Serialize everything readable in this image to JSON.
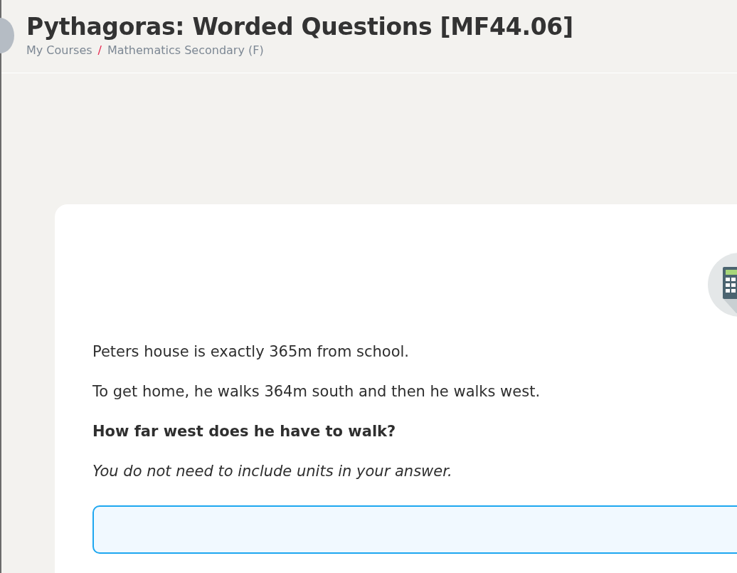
{
  "header": {
    "title": "Pythagoras: Worded Questions [MF44.06]",
    "breadcrumb": [
      {
        "label": "My Courses"
      },
      {
        "label": "Mathematics Secondary (F)"
      }
    ],
    "separator": "/"
  },
  "question": {
    "paragraphs": [
      {
        "kind": "plain",
        "text": "Peters house is exactly 365m from school."
      },
      {
        "kind": "plain",
        "text": "To get home, he walks 364m south and then he walks west."
      },
      {
        "kind": "bold",
        "text": "How far west does he have to walk?"
      },
      {
        "kind": "italic",
        "text": "You do not need to include units in your answer."
      }
    ]
  }
}
